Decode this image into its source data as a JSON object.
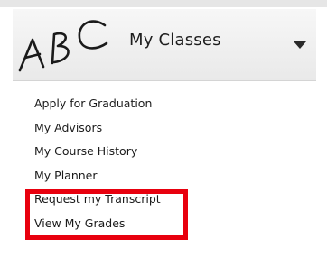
{
  "header": {
    "logo_text": "ABC",
    "title": "My Classes",
    "toggle_icon": "chevron-down-icon"
  },
  "menu": {
    "items": [
      {
        "label": "Apply for Graduation"
      },
      {
        "label": "My Advisors"
      },
      {
        "label": "My Course History"
      },
      {
        "label": "My Planner"
      },
      {
        "label": "Request my Transcript"
      },
      {
        "label": "View My Grades"
      }
    ]
  },
  "colors": {
    "highlight": "#e8000e",
    "header_bg": "#eeeeee",
    "text": "#1b1b1b"
  }
}
